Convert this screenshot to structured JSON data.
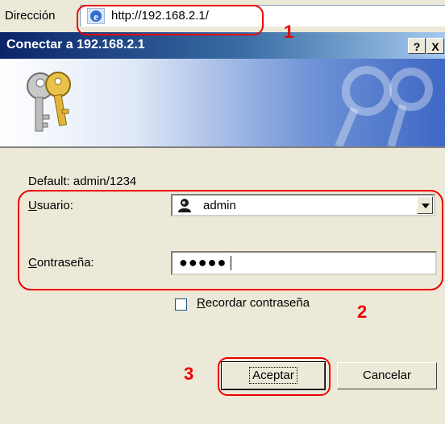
{
  "address_bar": {
    "label": "Dirección",
    "url": "http://192.168.2.1/"
  },
  "dialog": {
    "title": "Conectar a 192.168.2.1",
    "help_label": "?",
    "close_label": "X",
    "default_hint": "Default: admin/1234",
    "username_label_underlined": "U",
    "username_label_rest": "suario:",
    "username_value": "admin",
    "password_label_underlined": "C",
    "password_label_rest": "ontraseña:",
    "password_value": "●●●●●",
    "remember_label_underlined": "R",
    "remember_label_rest": "ecordar contraseña",
    "remember_checked": false,
    "ok_label": "Aceptar",
    "cancel_label": "Cancelar"
  },
  "annotations": {
    "step1": "1",
    "step2": "2",
    "step3": "3",
    "color": "#e00000"
  },
  "colors": {
    "title_bar": "#0a246a",
    "dialog_bg": "#ece9d8"
  },
  "icons": [
    "ie-globe-icon",
    "keys-icon",
    "user-icon",
    "chevron-down-icon"
  ]
}
